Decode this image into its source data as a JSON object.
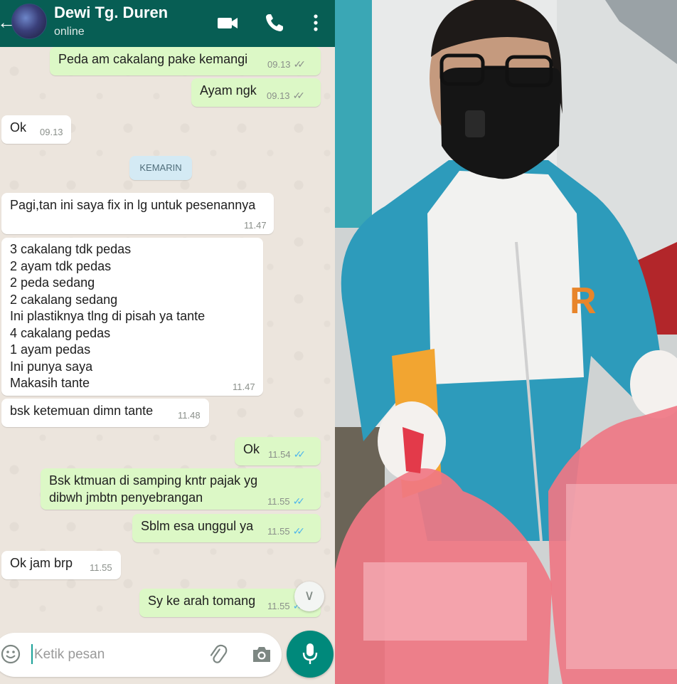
{
  "header": {
    "contact_name": "Dewi Tg. Duren",
    "status": "online",
    "icons": [
      "back-arrow-icon",
      "avatar",
      "video-call-icon",
      "phone-icon",
      "more-vertical-icon"
    ],
    "color": "#075e54"
  },
  "messages": [
    {
      "dir": "out",
      "text": "Peda am cakalang pake kemangi",
      "time": "09.13",
      "ticks": "sent"
    },
    {
      "dir": "out",
      "text": "Ayam ngk",
      "time": "09.13",
      "ticks": "sent"
    },
    {
      "dir": "in",
      "text": "Ok",
      "time": "09.13"
    },
    {
      "dir": "in",
      "text": "Pagi,tan ini saya fix in lg untuk pesenannya",
      "time": "11.47"
    },
    {
      "dir": "in",
      "lines": [
        "3 cakalang tdk pedas",
        "2 ayam tdk pedas",
        "2 peda sedang",
        "2 cakalang sedang",
        "Ini plastiknya tlng di pisah ya tante",
        "4 cakalang pedas",
        "1 ayam pedas",
        "Ini punya saya",
        "Makasih tante"
      ],
      "time": "11.47"
    },
    {
      "dir": "in",
      "text": "bsk ketemuan dimn tante",
      "time": "11.48"
    },
    {
      "dir": "out",
      "text": "Ok",
      "time": "11.54",
      "ticks": "read"
    },
    {
      "dir": "out",
      "lines": [
        "Bsk ktmuan di samping kntr pajak yg",
        "dibwh jmbtn penyebrangan"
      ],
      "time": "11.55",
      "ticks": "read"
    },
    {
      "dir": "out",
      "text": "Sblm esa unggul ya",
      "time": "11.55",
      "ticks": "read"
    },
    {
      "dir": "in",
      "text": "Ok jam brp",
      "time": "11.55"
    },
    {
      "dir": "out",
      "text": "Sy ke arah tomang",
      "time": "11.55",
      "ticks": "read"
    }
  ],
  "day_separator": "KEMARIN",
  "composer": {
    "placeholder": "Ketik pesan",
    "icons": [
      "emoji-icon",
      "attach-icon",
      "camera-icon",
      "mic-icon",
      "scroll-down-icon"
    ],
    "mic_color": "#00897b"
  },
  "colors": {
    "outgoing_bubble": "#dcf8c6",
    "incoming_bubble": "#ffffff",
    "chat_background": "#ece5dd",
    "read_ticks": "#4fb6ec"
  }
}
